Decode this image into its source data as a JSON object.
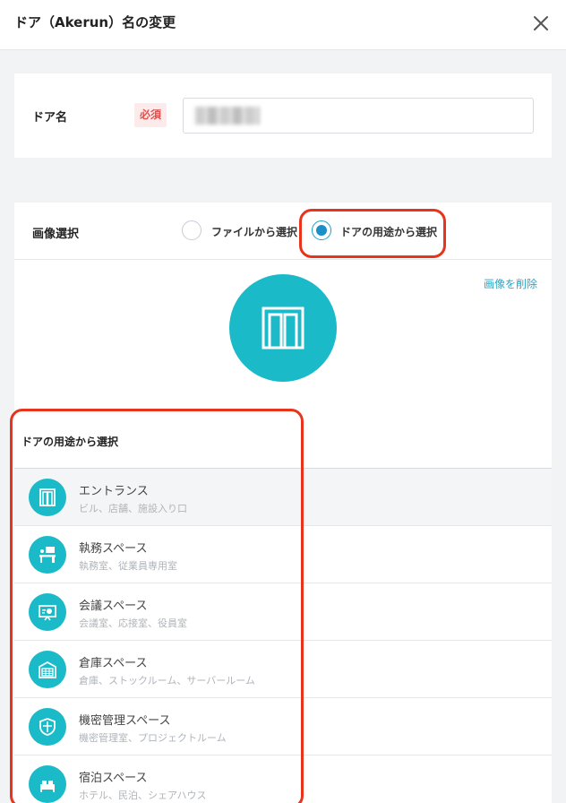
{
  "header": {
    "title": "ドア（Akerun）名の変更"
  },
  "door_name": {
    "label": "ドア名",
    "required": "必須",
    "value": ""
  },
  "image_select": {
    "label": "画像選択",
    "options": [
      {
        "label": "ファイルから選択",
        "checked": false
      },
      {
        "label": "ドアの用途から選択",
        "checked": true
      }
    ],
    "delete_label": "画像を削除"
  },
  "purpose": {
    "title": "ドアの用途から選択",
    "items": [
      {
        "name": "エントランス",
        "desc": "ビル、店舗、施設入り口",
        "icon": "door-icon",
        "selected": true
      },
      {
        "name": "執務スペース",
        "desc": "執務室、従業員専用室",
        "icon": "desk-icon",
        "selected": false
      },
      {
        "name": "会議スペース",
        "desc": "会議室、応接室、役員室",
        "icon": "presentation-icon",
        "selected": false
      },
      {
        "name": "倉庫スペース",
        "desc": "倉庫、ストックルーム、サーバールーム",
        "icon": "warehouse-icon",
        "selected": false
      },
      {
        "name": "機密管理スペース",
        "desc": "機密管理室、プロジェクトルーム",
        "icon": "shield-icon",
        "selected": false
      },
      {
        "name": "宿泊スペース",
        "desc": "ホテル、民泊、シェアハウス",
        "icon": "bed-icon",
        "selected": false
      }
    ]
  },
  "colors": {
    "accent": "#1bbac9",
    "highlight": "#e8341c",
    "required": "#e0504c",
    "link": "#2aa7c8"
  }
}
